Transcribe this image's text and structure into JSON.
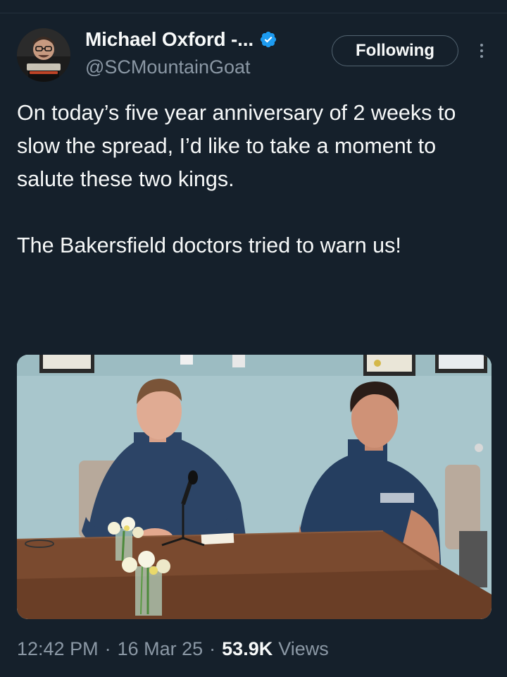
{
  "tweet": {
    "author": {
      "display_name": "Michael Oxford -...",
      "handle": "@SCMountainGoat",
      "verified": true,
      "verified_color": "#1d9bf0",
      "avatar_caption": "Michael Oxford"
    },
    "follow_button_label": "Following",
    "more_icon": "more-vertical-icon",
    "text_paragraphs": [
      "On today’s five year anniversary of 2 weeks to slow the spread, I’d like to take a moment to salute these two kings.",
      "The Bakersfield doctors tried to warn us!"
    ],
    "media": {
      "alt": "Two doctors in navy scrubs seated at a conference table with a microphone and flowers"
    },
    "meta": {
      "time": "12:42 PM",
      "separator": "·",
      "date": "16 Mar 25",
      "views_count": "53.9K",
      "views_label": "Views"
    }
  },
  "colors": {
    "background": "#15202b",
    "text_primary": "#f7f9f9",
    "text_secondary": "#8b98a5",
    "accent": "#1d9bf0"
  }
}
